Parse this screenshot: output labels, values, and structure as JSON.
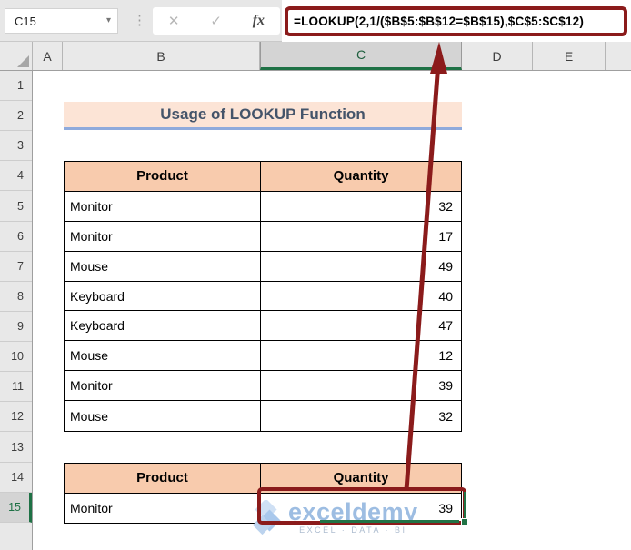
{
  "formula_bar": {
    "name_box": "C15",
    "cancel_icon": "✕",
    "enter_icon": "✓",
    "fx_icon": "fx",
    "dropdown_icon": "▾",
    "more_icon": "⋮",
    "formula": "=LOOKUP(2,1/($B$5:$B$12=$B$15),$C$5:$C$12)"
  },
  "grid": {
    "columns": [
      "A",
      "B",
      "C",
      "D",
      "E"
    ],
    "selected_column": "C",
    "rows": [
      "1",
      "2",
      "3",
      "4",
      "5",
      "6",
      "7",
      "8",
      "9",
      "10",
      "11",
      "12",
      "13",
      "14",
      "15"
    ],
    "selected_row": "15"
  },
  "sheet": {
    "title": "Usage of LOOKUP Function",
    "table1": {
      "headers": {
        "product": "Product",
        "quantity": "Quantity"
      },
      "rows": [
        {
          "product": "Monitor",
          "quantity": "32"
        },
        {
          "product": "Monitor",
          "quantity": "17"
        },
        {
          "product": "Mouse",
          "quantity": "49"
        },
        {
          "product": "Keyboard",
          "quantity": "40"
        },
        {
          "product": "Keyboard",
          "quantity": "47"
        },
        {
          "product": "Mouse",
          "quantity": "12"
        },
        {
          "product": "Monitor",
          "quantity": "39"
        },
        {
          "product": "Mouse",
          "quantity": "32"
        }
      ]
    },
    "table2": {
      "headers": {
        "product": "Product",
        "quantity": "Quantity"
      },
      "rows": [
        {
          "product": "Monitor",
          "quantity": "39"
        }
      ]
    }
  },
  "watermark": {
    "brand": "exceldemy",
    "tagline": "EXCEL · DATA · BI"
  },
  "colors": {
    "accent_red": "#8B1B1B",
    "selection_green": "#217346",
    "table_header_fill": "#F8CBAD",
    "title_fill": "#FCE4D6",
    "title_text": "#44546A",
    "title_underline": "#8FAADC",
    "watermark_blue": "#9DBDE2"
  }
}
